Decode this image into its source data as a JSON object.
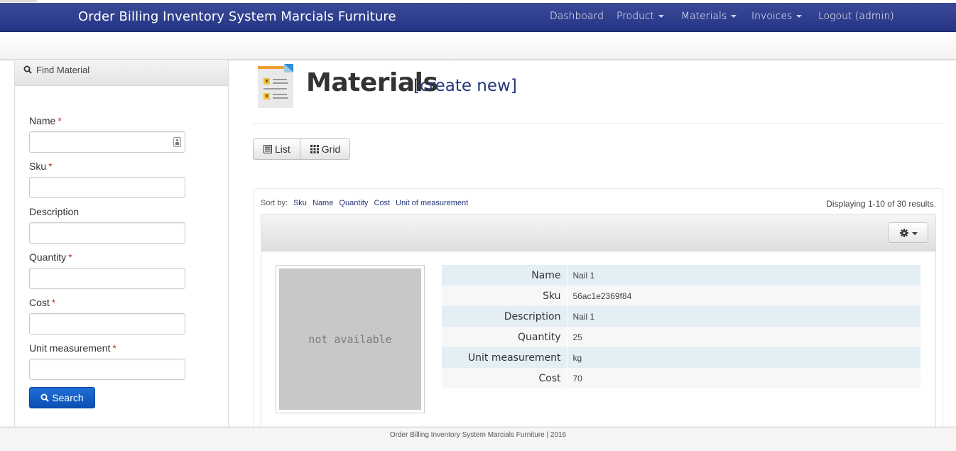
{
  "app": {
    "title": "Order Billing Inventory System Marcials Furniture"
  },
  "nav": {
    "items": [
      {
        "label": "Dashboard",
        "dropdown": false
      },
      {
        "label": "Product",
        "dropdown": true
      },
      {
        "label": "Materials",
        "dropdown": true
      },
      {
        "label": "Invoices",
        "dropdown": true
      },
      {
        "label": "Logout (admin)",
        "dropdown": false
      }
    ]
  },
  "sidebar": {
    "title": "Find Material",
    "icon": "search-icon",
    "fields": [
      {
        "label": "Name",
        "required": true,
        "value": ""
      },
      {
        "label": "Sku",
        "required": true,
        "value": ""
      },
      {
        "label": "Description",
        "required": false,
        "value": ""
      },
      {
        "label": "Quantity",
        "required": true,
        "value": ""
      },
      {
        "label": "Cost",
        "required": true,
        "value": ""
      },
      {
        "label": "Unit measurement",
        "required": true,
        "value": ""
      }
    ],
    "required_mark": "*",
    "search_label": "Search"
  },
  "main": {
    "title": "Materials",
    "create_link": "[create new]",
    "views": {
      "list_label": "List",
      "grid_label": "Grid"
    },
    "sort": {
      "label": "Sort by:",
      "options": [
        "Sku",
        "Name",
        "Quantity",
        "Cost",
        "Unit of measurement"
      ]
    },
    "summary": "Displaying 1-10 of 30 results.",
    "item": {
      "image_text": "not available",
      "fields": [
        {
          "label": "Name",
          "value": "Nail 1"
        },
        {
          "label": "Sku",
          "value": "56ac1e2369f84"
        },
        {
          "label": "Description",
          "value": "Nail 1"
        },
        {
          "label": "Quantity",
          "value": "25"
        },
        {
          "label": "Unit measurement",
          "value": "kg"
        },
        {
          "label": "Cost",
          "value": "70"
        }
      ]
    }
  },
  "footer": {
    "text": "Order Billing Inventory System Marcials Furniture | 2016"
  },
  "colors": {
    "navbar": "#2c3b8c",
    "link": "#26357a",
    "primary_button": "#1565c9",
    "required": "#c0392b"
  }
}
